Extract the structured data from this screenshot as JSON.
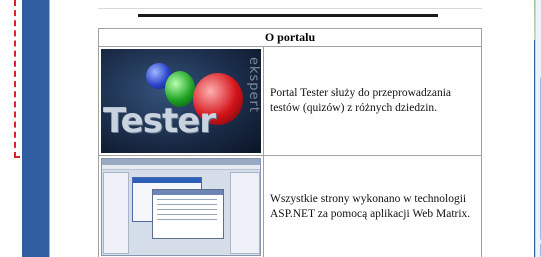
{
  "portal": {
    "section_title": "O portalu",
    "rows": [
      {
        "text": "Portal Tester służy do przeprowadzania testów (quizów) z różnych dziedzin.",
        "image": {
          "word": "Tester",
          "vertical_word": "ekspert"
        }
      },
      {
        "text": "Wszystkie strony wykonano w technologii ASP.NET za pomocą aplikacji Web Matrix."
      }
    ]
  },
  "colors": {
    "callout": "#d9232a",
    "frame": "#3a72b8",
    "scrollbar_thumb": "#c9d9f3"
  }
}
